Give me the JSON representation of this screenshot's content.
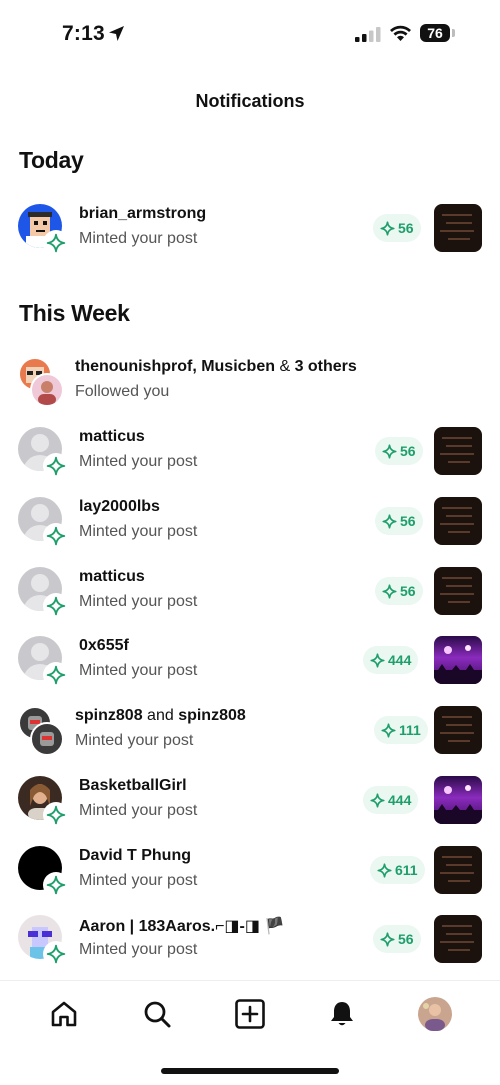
{
  "status_bar": {
    "time": "7:13",
    "battery": "76"
  },
  "header": {
    "title": "Notifications"
  },
  "sections": {
    "today": "Today",
    "this_week": "This Week"
  },
  "notifications": [
    {
      "name": "brian_armstrong",
      "action": "Minted your post",
      "count": "56",
      "avatar": "pixel-avatar",
      "thumb": "dark-artwork"
    },
    {
      "name_parts": [
        "thenounishprof, Musicben",
        " & ",
        "3 others"
      ],
      "action": "Followed you",
      "avatar": "stacked-avatars"
    },
    {
      "name": "matticus",
      "action": "Minted your post",
      "count": "56",
      "avatar": "default-avatar",
      "thumb": "dark-artwork"
    },
    {
      "name": "lay2000lbs",
      "action": "Minted your post",
      "count": "56",
      "avatar": "default-avatar",
      "thumb": "dark-artwork"
    },
    {
      "name": "matticus",
      "action": "Minted your post",
      "count": "56",
      "avatar": "default-avatar",
      "thumb": "dark-artwork"
    },
    {
      "name": "0x655f",
      "action": "Minted your post",
      "count": "444",
      "avatar": "default-avatar",
      "thumb": "concert-photo"
    },
    {
      "name_parts": [
        "spinz808",
        " and ",
        "spinz808"
      ],
      "action": "Minted your post",
      "count": "111",
      "avatar": "stacked-avatars",
      "thumb": "dark-artwork"
    },
    {
      "name": "BasketballGirl",
      "action": "Minted your post",
      "count": "444",
      "avatar": "photo-avatar",
      "thumb": "concert-photo"
    },
    {
      "name": "David T Phung",
      "action": "Minted your post",
      "count": "611",
      "avatar": "black-avatar",
      "thumb": "dark-artwork"
    },
    {
      "name": "Aaron | 183Aaros.⌐◨-◨ 🏴",
      "action": "Minted your post",
      "count": "56",
      "avatar": "noggles-avatar",
      "thumb": "dark-artwork"
    }
  ],
  "tab_bar": {
    "items": [
      "home-icon",
      "search-icon",
      "create-icon",
      "bell-icon",
      "profile-avatar"
    ]
  },
  "colors": {
    "accent_green": "#1e9e6a",
    "pill_bg": "#eaf8f1"
  }
}
